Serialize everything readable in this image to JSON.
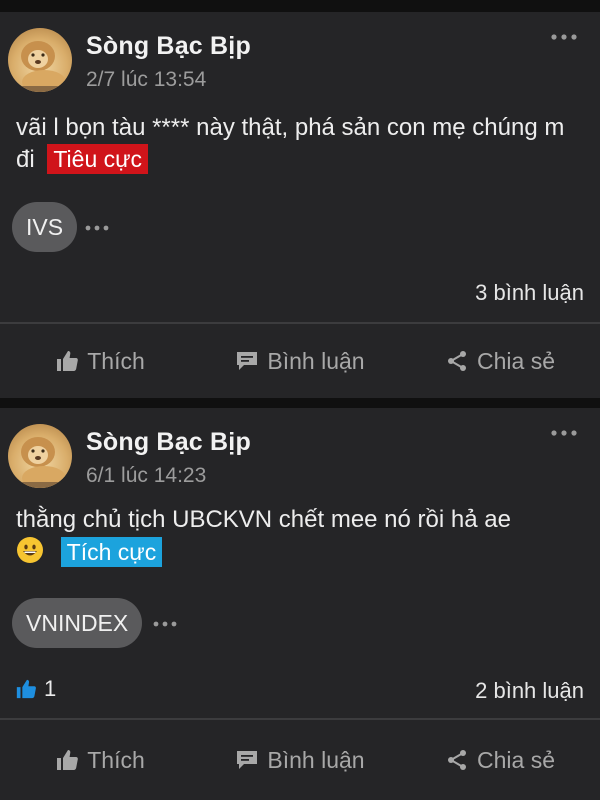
{
  "posts": [
    {
      "author": "Sòng Bạc Bịp",
      "timestamp": "2/7 lúc 13:54",
      "text": "vãi l bọn tàu **** này thật, phá sản con mẹ chúng m đi",
      "sentiment": "Tiêu cực",
      "sentiment_color": "#d0141a",
      "tag": "IVS",
      "like_count": "",
      "comments": "3 bình luận"
    },
    {
      "author": "Sòng Bạc Bịp",
      "timestamp": "6/1 lúc 14:23",
      "text": "thằng chủ tịch UBCKVN chết mee nó rồi hả ae",
      "sentiment": "Tích cực",
      "sentiment_color": "#1ca3dd",
      "tag": "VNINDEX",
      "like_count": "1",
      "comments": "2 bình luận"
    }
  ],
  "actions": {
    "like": "Thích",
    "comment": "Bình luận",
    "share": "Chia sẻ"
  },
  "icons": [
    "more-icon",
    "thumbs-up-icon",
    "comment-icon",
    "share-icon",
    "grinning-emoji-icon"
  ]
}
